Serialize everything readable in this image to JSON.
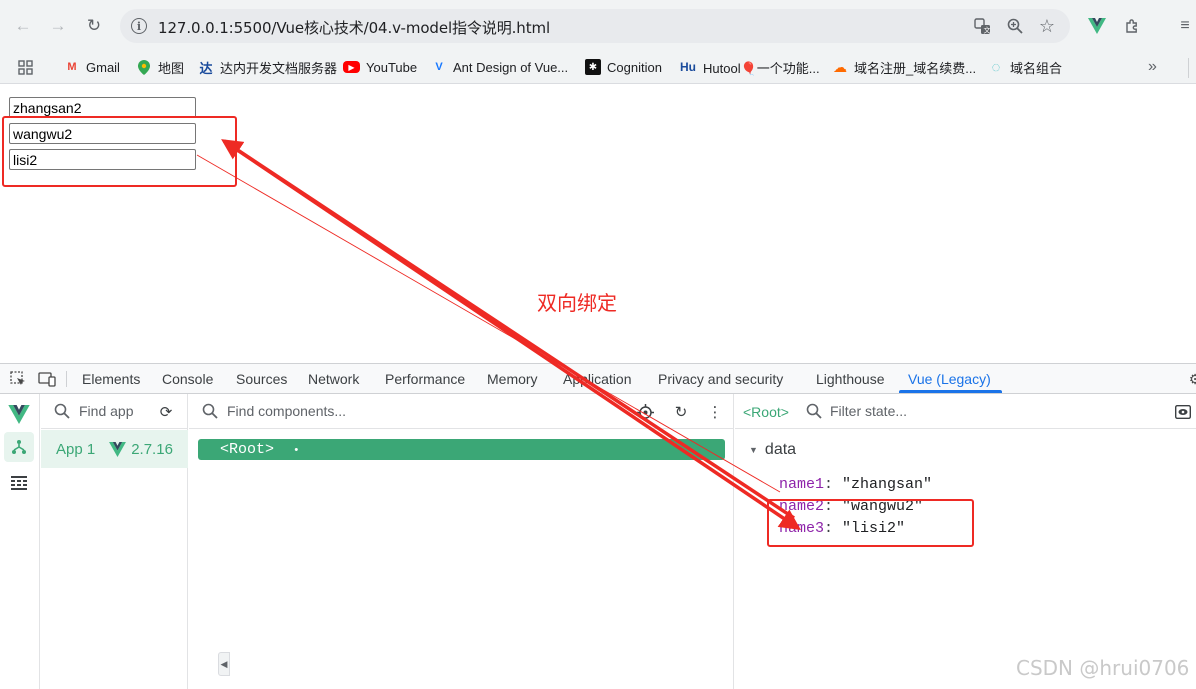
{
  "browser": {
    "url": "127.0.0.1:5500/Vue核心技术/04.v-model指令说明.html",
    "bookmarks": [
      {
        "label": "Gmail",
        "icon": "gmail-icon",
        "color": "#ea4335",
        "glyph": "M"
      },
      {
        "label": "地图",
        "icon": "maps-icon",
        "color": "#34a853",
        "glyph": "●"
      },
      {
        "label": "达内开发文档服务器",
        "icon": "tarena-icon",
        "color": "#1a4b9c",
        "glyph": "达"
      },
      {
        "label": "YouTube",
        "icon": "youtube-icon",
        "color": "#ff0000",
        "glyph": "▶"
      },
      {
        "label": "Ant Design of Vue...",
        "icon": "antdv-icon",
        "color": "#1677ff",
        "glyph": "V"
      },
      {
        "label": "Cognition",
        "icon": "cognition-icon",
        "color": "#111111",
        "glyph": "✱"
      },
      {
        "label": "Hutool🎈一个功能...",
        "icon": "hutool-icon",
        "color": "#1a4b9c",
        "glyph": "Hu"
      },
      {
        "label": "域名注册_域名续费...",
        "icon": "cloud-icon",
        "color": "#ff6a00",
        "glyph": "☁"
      },
      {
        "label": "域名组合",
        "icon": "swirl-icon",
        "color": "#4fc3c7",
        "glyph": "◌"
      }
    ],
    "more_bookmarks": "»"
  },
  "page": {
    "inputs": [
      "zhangsan2",
      "wangwu2",
      "lisi2"
    ],
    "annotation": "双向绑定"
  },
  "devtools": {
    "tabs": [
      "Elements",
      "Console",
      "Sources",
      "Network",
      "Performance",
      "Memory",
      "Application",
      "Privacy and security",
      "Lighthouse",
      "Vue (Legacy)"
    ],
    "active_tab": "Vue (Legacy)",
    "find_apps_placeholder": "Find apps",
    "find_components_placeholder": "Find components...",
    "filter_state_placeholder": "Filter state...",
    "app_name": "App 1",
    "vue_version": "2.7.16",
    "root_component": "<Root>",
    "selected_component": "<Root>",
    "state_section": "data",
    "state": [
      {
        "key": "name1",
        "value": "\"zhangsan\""
      },
      {
        "key": "name2",
        "value": "\"wangwu2\""
      },
      {
        "key": "name3",
        "value": "\"lisi2\""
      }
    ]
  },
  "watermark": "CSDN @hrui0706",
  "colors": {
    "vue_green": "#3ba776",
    "annotation_red": "#ee2a24",
    "devtools_blue": "#1a73e8"
  }
}
